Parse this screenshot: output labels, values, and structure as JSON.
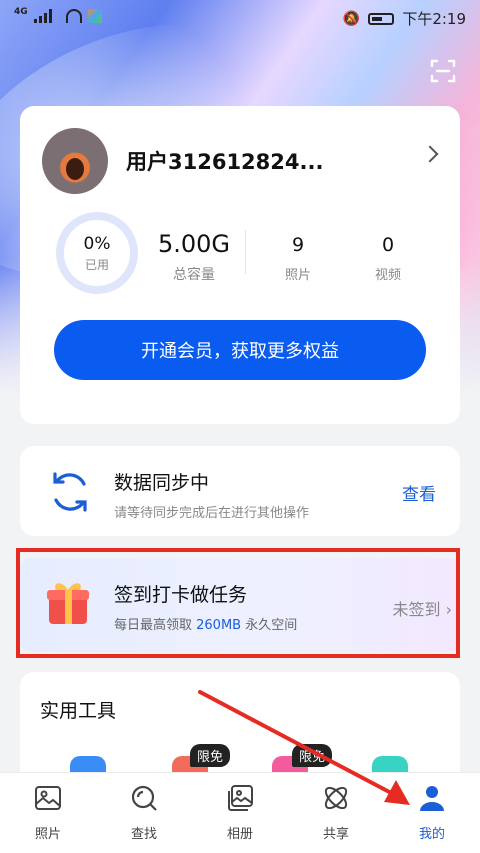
{
  "status_bar": {
    "network": "4G",
    "time": "下午2:19"
  },
  "profile": {
    "username": "用户312612824...",
    "storage": {
      "used_percent": "0%",
      "used_label": "已用",
      "total": "5.00G",
      "total_label": "总容量"
    },
    "photos": {
      "count": "9",
      "label": "照片"
    },
    "videos": {
      "count": "0",
      "label": "视频"
    },
    "vip_button": "开通会员，获取更多权益"
  },
  "sync": {
    "title": "数据同步中",
    "subtitle": "请等待同步完成后在进行其他操作",
    "link": "查看"
  },
  "task": {
    "title": "签到打卡做任务",
    "subtitle_prefix": "每日最高领取 ",
    "subtitle_highlight": "260MB",
    "subtitle_suffix": " 永久空间",
    "status": "未签到"
  },
  "tools": {
    "title": "实用工具",
    "badges": [
      "限免",
      "限免"
    ]
  },
  "tabbar": [
    {
      "label": "照片",
      "icon": "photo-icon"
    },
    {
      "label": "查找",
      "icon": "search-icon"
    },
    {
      "label": "相册",
      "icon": "album-icon"
    },
    {
      "label": "共享",
      "icon": "share-icon"
    },
    {
      "label": "我的",
      "icon": "profile-icon",
      "active": true
    }
  ],
  "colors": {
    "accent": "#0a5bf0",
    "link": "#1a5fd6",
    "highlight_box": "#e62b22"
  }
}
